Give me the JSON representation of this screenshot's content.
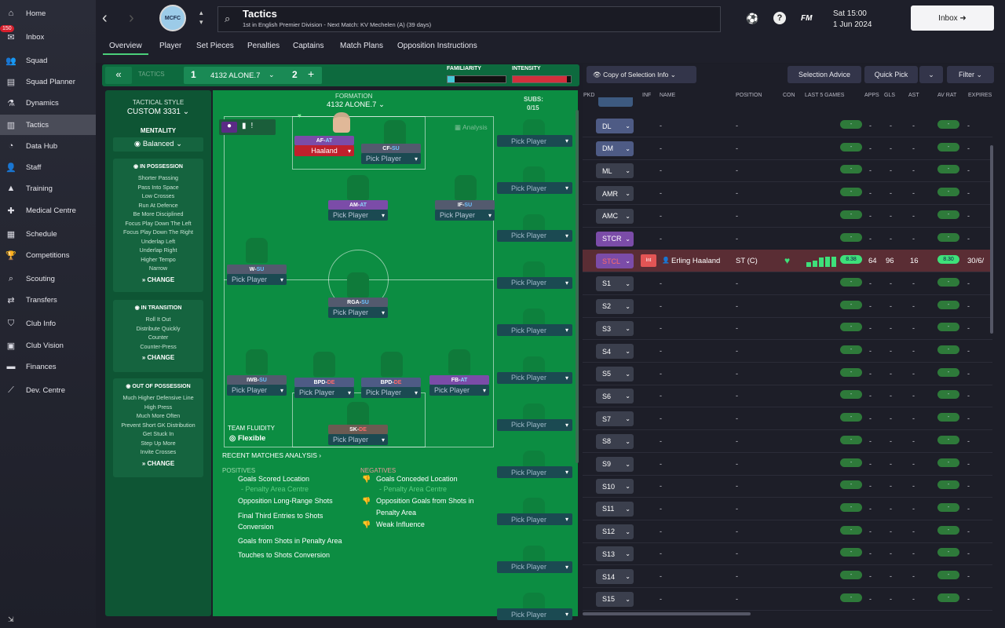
{
  "sidebar": {
    "items": [
      {
        "label": "Home",
        "icon": "home-icon",
        "glyph": "⌂"
      },
      {
        "label": "Inbox",
        "icon": "inbox-icon",
        "glyph": "✉",
        "badge": "150"
      },
      {
        "label": "Squad",
        "icon": "squad-icon",
        "glyph": "👥"
      },
      {
        "label": "Squad Planner",
        "icon": "planner-icon",
        "glyph": "▤"
      },
      {
        "label": "Dynamics",
        "icon": "dynamics-icon",
        "glyph": "⚗"
      },
      {
        "label": "Tactics",
        "icon": "tactics-icon",
        "glyph": "▥"
      },
      {
        "label": "Data Hub",
        "icon": "datahub-icon",
        "glyph": "◔"
      },
      {
        "label": "Staff",
        "icon": "staff-icon",
        "glyph": "👤"
      },
      {
        "label": "Training",
        "icon": "training-icon",
        "glyph": "▲"
      },
      {
        "label": "Medical Centre",
        "icon": "medical-icon",
        "glyph": "✚"
      },
      {
        "label": "Schedule",
        "icon": "schedule-icon",
        "glyph": "▦"
      },
      {
        "label": "Competitions",
        "icon": "trophy-icon",
        "glyph": "🏆"
      },
      {
        "label": "Scouting",
        "icon": "scouting-icon",
        "glyph": "⌕"
      },
      {
        "label": "Transfers",
        "icon": "transfers-icon",
        "glyph": "⇄"
      },
      {
        "label": "Club Info",
        "icon": "clubinfo-icon",
        "glyph": "⛉"
      },
      {
        "label": "Club Vision",
        "icon": "clubvision-icon",
        "glyph": "▣"
      },
      {
        "label": "Finances",
        "icon": "finances-icon",
        "glyph": "▬"
      },
      {
        "label": "Dev. Centre",
        "icon": "devcentre-icon",
        "glyph": "⟋"
      }
    ]
  },
  "header": {
    "title": "Tactics",
    "subtitle": "1st in English Premier Division - Next Match: KV Mechelen (A) (39 days)",
    "date_time": "Sat 15:00",
    "date": "1 Jun 2024",
    "inbox_label": "Inbox",
    "fm_label": "FM",
    "help_label": "?",
    "tabs": [
      "Overview",
      "Player",
      "Set Pieces",
      "Penalties",
      "Captains",
      "Match Plans",
      "Opposition Instructions"
    ]
  },
  "tactic_bar": {
    "tactics_label": "TACTICS",
    "tactic1_num": "1",
    "tactic1_name": "4132 ALONE.7",
    "tactic2_num": "2",
    "add": "+",
    "familiarity": "FAMILIARITY",
    "intensity": "INTENSITY"
  },
  "style": {
    "title": "TACTICAL STYLE",
    "value": "CUSTOM 3331",
    "mentality_label": "MENTALITY",
    "mentality": "Balanced",
    "in_possession": {
      "title": "IN POSSESSION",
      "items": [
        "Shorter Passing",
        "Pass Into Space",
        "Low Crosses",
        "Run At Defence",
        "Be More Disciplined",
        "Focus Play Down The Left",
        "Focus Play Down The Right",
        "Underlap Left",
        "Underlap Right",
        "Higher Tempo",
        "Narrow"
      ]
    },
    "in_transition": {
      "title": "IN TRANSITION",
      "items": [
        "Roll It Out",
        "Distribute Quickly",
        "Counter",
        "Counter-Press"
      ]
    },
    "out_possession": {
      "title": "OUT OF POSSESSION",
      "items": [
        "Much Higher Defensive Line",
        "High Press",
        "Much More Often",
        "Prevent Short GK Distribution",
        "Get Stuck In",
        "Step Up More",
        "Invite Crosses"
      ]
    },
    "change": "CHANGE"
  },
  "pitch": {
    "formation_label": "FORMATION",
    "formation": "4132 ALONE.7",
    "subs_label": "SUBS:",
    "subs_count": "0/15",
    "analysis": "Analysis",
    "fluidity_label": "TEAM FLUIDITY",
    "fluidity": "Flexible",
    "pick": "Pick Player",
    "roles": [
      {
        "role": "AF",
        "duty": "AT",
        "player": "Haaland"
      },
      {
        "role": "CF",
        "duty": "SU",
        "player": "Pick Player"
      },
      {
        "role": "AM",
        "duty": "AT",
        "player": "Pick Player"
      },
      {
        "role": "IF",
        "duty": "SU",
        "player": "Pick Player"
      },
      {
        "role": "W",
        "duty": "SU",
        "player": "Pick Player"
      },
      {
        "role": "RGA",
        "duty": "SU",
        "player": "Pick Player"
      },
      {
        "role": "IWB",
        "duty": "SU",
        "player": "Pick Player"
      },
      {
        "role": "BPD",
        "duty": "DE",
        "player": "Pick Player"
      },
      {
        "role": "BPD",
        "duty": "DE",
        "player": "Pick Player"
      },
      {
        "role": "FB",
        "duty": "AT",
        "player": "Pick Player"
      },
      {
        "role": "SK",
        "duty": "DE",
        "player": "Pick Player"
      }
    ]
  },
  "analysis": {
    "title": "RECENT MATCHES ANALYSIS",
    "positives_label": "POSITIVES",
    "negatives_label": "NEGATIVES",
    "positives": [
      "Goals Scored Location",
      "- Penalty Area Centre",
      "Opposition Long-Range Shots",
      "Final Third Entries to Shots",
      "Conversion",
      "Goals from Shots in Penalty Area",
      "Touches to Shots Conversion"
    ],
    "negatives": [
      "Goals Conceded Location",
      "- Penalty Area Centre",
      "Opposition Goals from Shots in",
      "Penalty Area",
      "Weak Influence"
    ]
  },
  "right": {
    "copy_label": "Copy of Selection Info",
    "selection_advice": "Selection Advice",
    "quick_pick": "Quick Pick",
    "filter": "Filter",
    "columns": [
      "PKD",
      "INF",
      "NAME",
      "POSITION",
      "CON",
      "LAST 5 GAMES",
      "APPS",
      "GLS",
      "AST",
      "AV RAT",
      "EXPIRES"
    ],
    "slots": [
      "DL",
      "DM",
      "ML",
      "AMR",
      "AMC",
      "STCR",
      "STCL",
      "S1",
      "S2",
      "S3",
      "S4",
      "S5",
      "S6",
      "S7",
      "S8",
      "S9",
      "S10",
      "S11",
      "S12",
      "S13",
      "S14",
      "S15"
    ],
    "player": {
      "inf": "Int",
      "name": "Erling Haaland",
      "position": "ST (C)",
      "form": "8.38",
      "apps": "64",
      "gls": "96",
      "ast": "16",
      "av_rat": "8.30",
      "expires": "30/6/"
    },
    "dash": "-"
  },
  "colors": {
    "accent": "#4bd07a",
    "pitch": "#0c8d42",
    "panel": "#0e5534",
    "attack": "#7b4ca8",
    "defend": "#d32f3c"
  }
}
